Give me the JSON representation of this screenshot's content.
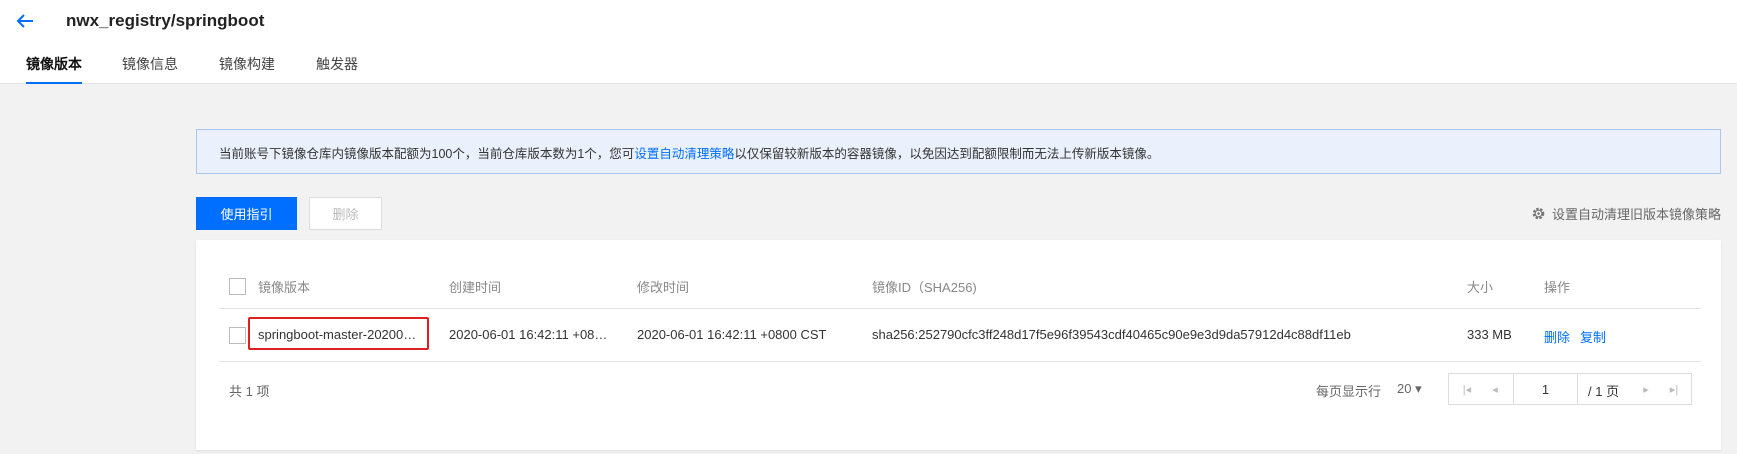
{
  "header": {
    "title": "nwx_registry/springboot",
    "tabs": [
      {
        "label": "镜像版本",
        "active": true
      },
      {
        "label": "镜像信息",
        "active": false
      },
      {
        "label": "镜像构建",
        "active": false
      },
      {
        "label": "触发器",
        "active": false
      }
    ]
  },
  "notice": {
    "text_before": "当前账号下镜像仓库内镜像版本配额为100个，当前仓库版本数为1个，您可",
    "link": "设置自动清理策略",
    "text_after": "以仅保留较新版本的容器镜像，以免因达到配额限制而无法上传新版本镜像。"
  },
  "toolbar": {
    "guide_label": "使用指引",
    "delete_label": "删除",
    "settings_label": "设置自动清理旧版本镜像策略",
    "settings_icon": "gear-icon"
  },
  "table": {
    "headers": {
      "version": "镜像版本",
      "created": "创建时间",
      "modified": "修改时间",
      "image_id": "镜像ID（SHA256)",
      "size": "大小",
      "ops": "操作"
    },
    "rows": [
      {
        "version": "springboot-master-20200…",
        "created": "2020-06-01 16:42:11 +08…",
        "modified": "2020-06-01 16:42:11 +0800 CST",
        "image_id": "sha256:252790cfc3ff248d17f5e96f39543cdf40465c90e9e3d9da57912d4c88df11eb",
        "size": "333 MB",
        "op_delete": "删除",
        "op_copy": "复制"
      }
    ]
  },
  "footer": {
    "total": "共 1 项",
    "per_page_label": "每页显示行",
    "per_page_value": "20 ▾",
    "current_page": "1",
    "total_pages": "/ 1 页"
  },
  "colors": {
    "accent": "#006eff",
    "highlight": "#e02020",
    "notice_bg": "#eaf1fc"
  }
}
